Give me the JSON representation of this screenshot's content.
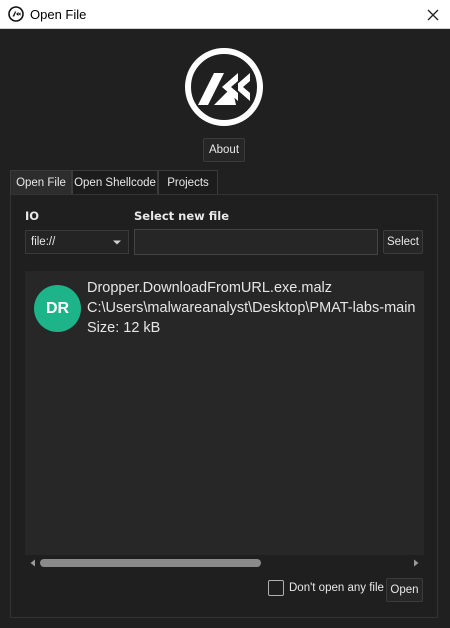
{
  "window": {
    "title": "Open File",
    "close_icon": "close-icon",
    "app_icon": "app-logo-icon"
  },
  "header": {
    "logo_icon": "rewind-logo-icon",
    "about_label": "About"
  },
  "tabs": [
    {
      "label": "Open File",
      "active": true
    },
    {
      "label": "Open Shellcode",
      "active": false
    },
    {
      "label": "Projects",
      "active": false
    }
  ],
  "form": {
    "io_label": "IO",
    "io_value": "file://",
    "new_file_label": "Select new file",
    "new_file_value": "",
    "select_button": "Select"
  },
  "recent_files": [
    {
      "initials": "DR",
      "avatar_color": "#1db48a",
      "name": "Dropper.DownloadFromURL.exe.malz",
      "path": "C:\\Users\\malwareanalyst\\Desktop\\PMAT-labs-main",
      "size": "Size: 12 kB"
    }
  ],
  "footer": {
    "dont_open_label": "Don't open any file",
    "dont_open_checked": false,
    "open_button": "Open"
  }
}
